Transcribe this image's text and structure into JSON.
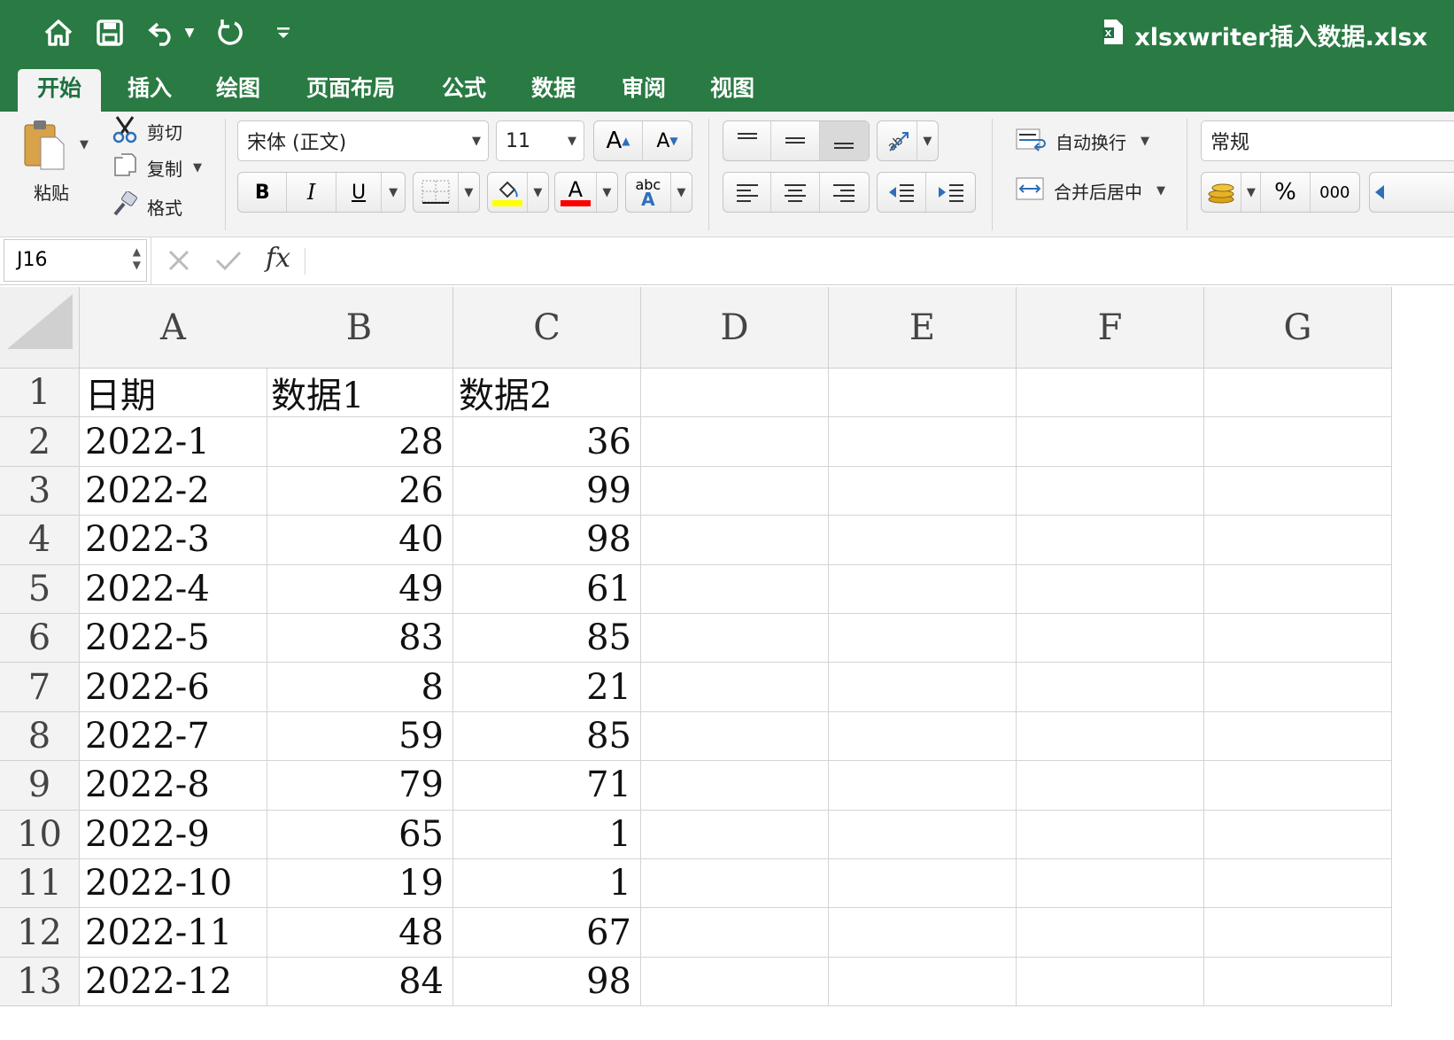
{
  "titlebar": {
    "document_title": "xlsxwriter插入数据.xlsx",
    "icons": [
      "home-icon",
      "save-icon",
      "undo-icon",
      "redo-icon",
      "customize-icon"
    ]
  },
  "tabs": [
    "开始",
    "插入",
    "绘图",
    "页面布局",
    "公式",
    "数据",
    "审阅",
    "视图"
  ],
  "active_tab": "开始",
  "ribbon": {
    "paste_label": "粘贴",
    "cut_label": "剪切",
    "copy_label": "复制",
    "format_label": "格式",
    "font_name": "宋体 (正文)",
    "font_size": "11",
    "wrap_text_label": "自动换行",
    "merge_center_label": "合并后居中",
    "number_format": "常规",
    "percent_label": "%",
    "thousands_label": "000",
    "bold_label": "B",
    "italic_label": "I",
    "underline_label": "U",
    "abc_label": "abc",
    "grow_font_label": "A",
    "shrink_font_label": "A",
    "fill_color": "#ffff00",
    "font_color": "#ff0000"
  },
  "formula_bar": {
    "name_box": "J16",
    "fx_label": "fx",
    "formula": ""
  },
  "sheet": {
    "columns": [
      "A",
      "B",
      "C",
      "D",
      "E",
      "F",
      "G"
    ],
    "rows": [
      {
        "n": "1",
        "a": "日期",
        "b": "数据1",
        "c": "数据2"
      },
      {
        "n": "2",
        "a": "2022-1",
        "b": "28",
        "c": "36"
      },
      {
        "n": "3",
        "a": "2022-2",
        "b": "26",
        "c": "99"
      },
      {
        "n": "4",
        "a": "2022-3",
        "b": "40",
        "c": "98"
      },
      {
        "n": "5",
        "a": "2022-4",
        "b": "49",
        "c": "61"
      },
      {
        "n": "6",
        "a": "2022-5",
        "b": "83",
        "c": "85"
      },
      {
        "n": "7",
        "a": "2022-6",
        "b": "8",
        "c": "21"
      },
      {
        "n": "8",
        "a": "2022-7",
        "b": "59",
        "c": "85"
      },
      {
        "n": "9",
        "a": "2022-8",
        "b": "79",
        "c": "71"
      },
      {
        "n": "10",
        "a": "2022-9",
        "b": "65",
        "c": "1"
      },
      {
        "n": "11",
        "a": "2022-10",
        "b": "19",
        "c": "1"
      },
      {
        "n": "12",
        "a": "2022-11",
        "b": "48",
        "c": "67"
      },
      {
        "n": "13",
        "a": "2022-12",
        "b": "84",
        "c": "98"
      }
    ]
  },
  "colors": {
    "title_bar": "#2a7a43",
    "active_tab_text": "#1f7040",
    "ribbon_bg": "#f3f3f3"
  }
}
